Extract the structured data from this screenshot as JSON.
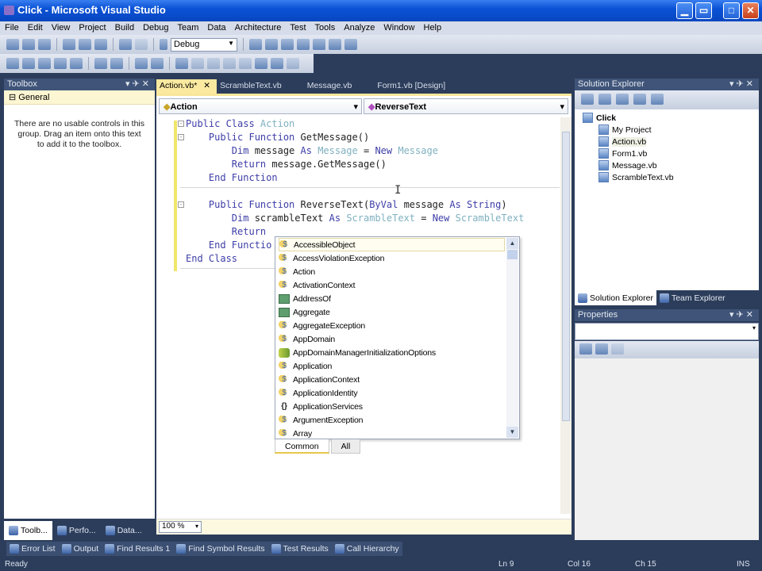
{
  "window": {
    "title": "Click - Microsoft Visual Studio",
    "controls": [
      "minimize",
      "restore",
      "maximize",
      "close"
    ]
  },
  "menu": [
    "File",
    "Edit",
    "View",
    "Project",
    "Build",
    "Debug",
    "Team",
    "Data",
    "Architecture",
    "Test",
    "Tools",
    "Analyze",
    "Window",
    "Help"
  ],
  "toolbar": {
    "config_value": "Debug"
  },
  "toolbox": {
    "title": "Toolbox",
    "group": "General",
    "empty_message": "There are no usable controls in this group. Drag an item onto this text to add it to the toolbox.",
    "tabs": [
      "Toolb...",
      "Perfo...",
      "Data..."
    ]
  },
  "editor": {
    "tabs": [
      {
        "label": "Action.vb*",
        "active": true
      },
      {
        "label": "ScrambleText.vb"
      },
      {
        "label": "Message.vb"
      },
      {
        "label": "Form1.vb [Design]"
      }
    ],
    "class_combo": "Action",
    "member_combo": "ReverseText",
    "zoom": "100 %",
    "lines": [
      [
        [
          "Public Class ",
          "k"
        ],
        [
          "Action",
          "ty"
        ]
      ],
      [
        [
          "    Public Function ",
          "k"
        ],
        [
          "GetMessage()",
          "id"
        ]
      ],
      [
        [
          "        Dim ",
          "k"
        ],
        [
          "message ",
          "id"
        ],
        [
          "As ",
          "k"
        ],
        [
          "Message",
          "ty"
        ],
        [
          " = ",
          "id"
        ],
        [
          "New ",
          "k"
        ],
        [
          "Message",
          "ty"
        ]
      ],
      [
        [
          "        Return ",
          "k"
        ],
        [
          "message.GetMessage()",
          "id"
        ]
      ],
      [
        [
          "    End Function",
          "k"
        ]
      ],
      [],
      [
        [
          "    Public Function ",
          "k"
        ],
        [
          "ReverseText(",
          "id"
        ],
        [
          "ByVal ",
          "k"
        ],
        [
          "message ",
          "id"
        ],
        [
          "As String",
          "k"
        ],
        [
          ")",
          "id"
        ]
      ],
      [
        [
          "        Dim ",
          "k"
        ],
        [
          "scrambleText ",
          "id"
        ],
        [
          "As ",
          "k"
        ],
        [
          "ScrambleText",
          "ty"
        ],
        [
          " = ",
          "id"
        ],
        [
          "New ",
          "k"
        ],
        [
          "ScrambleText",
          "ty"
        ]
      ],
      [
        [
          "        Return",
          "k"
        ]
      ],
      [
        [
          "    End Functio",
          "k"
        ]
      ],
      [
        [
          "End Class",
          "k"
        ]
      ]
    ]
  },
  "intellisense": {
    "items": [
      {
        "label": "AccessibleObject",
        "icon": "class"
      },
      {
        "label": "AccessViolationException",
        "icon": "class"
      },
      {
        "label": "Action",
        "icon": "class"
      },
      {
        "label": "ActivationContext",
        "icon": "class"
      },
      {
        "label": "AddressOf",
        "icon": "keyword"
      },
      {
        "label": "Aggregate",
        "icon": "keyword"
      },
      {
        "label": "AggregateException",
        "icon": "class"
      },
      {
        "label": "AppDomain",
        "icon": "class"
      },
      {
        "label": "AppDomainManagerInitializationOptions",
        "icon": "enum"
      },
      {
        "label": "Application",
        "icon": "class"
      },
      {
        "label": "ApplicationContext",
        "icon": "class"
      },
      {
        "label": "ApplicationIdentity",
        "icon": "class"
      },
      {
        "label": "ApplicationServices",
        "icon": "namespace"
      },
      {
        "label": "ArgumentException",
        "icon": "class"
      },
      {
        "label": "Array",
        "icon": "class"
      }
    ],
    "tabs": [
      "Common",
      "All"
    ]
  },
  "solution_explorer": {
    "title": "Solution Explorer",
    "root": "Click",
    "items": [
      "My Project",
      "Action.vb",
      "Form1.vb",
      "Message.vb",
      "ScrambleText.vb"
    ],
    "tabs": [
      "Solution Explorer",
      "Team Explorer"
    ]
  },
  "properties": {
    "title": "Properties"
  },
  "bottom_tabs": [
    "Error List",
    "Output",
    "Find Results 1",
    "Find Symbol Results",
    "Test Results",
    "Call Hierarchy"
  ],
  "status": {
    "text": "Ready",
    "ln": "Ln 9",
    "col": "Col 16",
    "ch": "Ch 15",
    "mode": "INS"
  }
}
